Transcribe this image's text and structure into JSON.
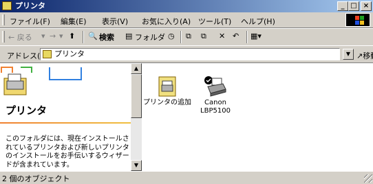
{
  "window": {
    "title": "プリンタ"
  },
  "menu": [
    "ファイル(F)",
    "編集(E)",
    "表示(V)",
    "お気に入り(A)",
    "ツール(T)",
    "ヘルプ(H)"
  ],
  "toolbar": {
    "back": "← 戻る",
    "forward": "→",
    "search": "検索",
    "folders": "フォルダ",
    "delete": "✕",
    "undo": "↶",
    "views": "▦▾"
  },
  "address": {
    "label": "アドレス(D)",
    "value": "プリンタ",
    "go": "移動"
  },
  "left_pane": {
    "title": "プリンタ",
    "description": "このフォルダには、現在インストールされているプリンタおよび新しいプリンタのインストールをお手伝いするウィザードが含まれています。"
  },
  "items": [
    {
      "label": "プリンタの追加",
      "icon": "add-printer-icon"
    },
    {
      "label": "Canon",
      "label2": "LBP5100",
      "icon": "printer-icon"
    }
  ],
  "status": {
    "text": "2 個のオブジェクト"
  }
}
